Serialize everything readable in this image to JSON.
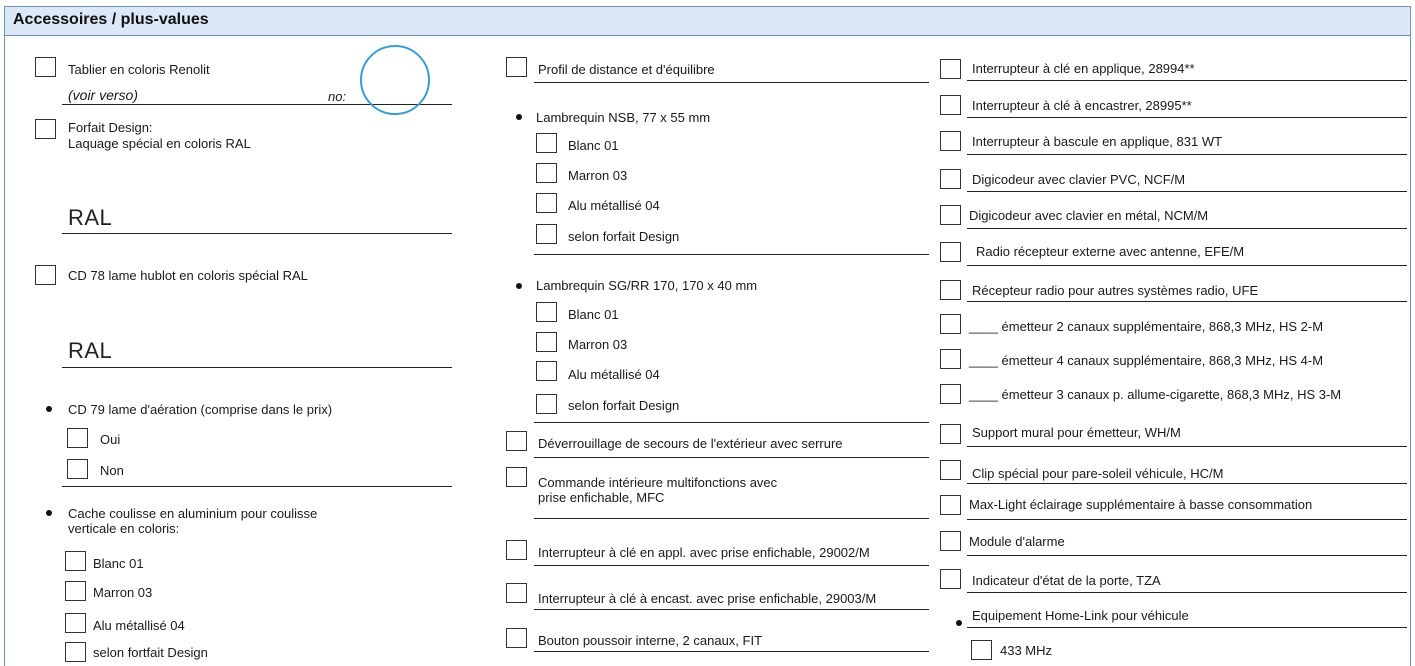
{
  "section_title": "Accessoires / plus-values",
  "col1": {
    "tablier": "Tablier en coloris Renolit",
    "voir_verso": "(voir verso)",
    "no": "no:",
    "forfait_design_1": "Forfait Design:",
    "forfait_design_2": "Laquage spécial en coloris RAL",
    "ral_1": "RAL",
    "cd78": "CD 78 lame hublot en coloris spécial RAL",
    "ral_2": "RAL",
    "cd79": "CD 79 lame d'aération (comprise dans le prix)",
    "oui": "Oui",
    "non": "Non",
    "cache_1": "Cache coulisse en aluminium pour coulisse",
    "cache_2": "verticale en coloris:",
    "blanc": "Blanc 01",
    "marron": "Marron 03",
    "alu": "Alu métallisé 04",
    "selon": "selon fortfait Design"
  },
  "col2": {
    "profil": "Profil de distance et d'équilibre",
    "lambrequin_nsb": "Lambrequin NSB, 77 x 55 mm",
    "nsb_blanc": "Blanc 01",
    "nsb_marron": "Marron 03",
    "nsb_alu": "Alu métallisé 04",
    "nsb_selon": "selon forfait Design",
    "lambrequin_sg": "Lambrequin SG/RR 170, 170 x 40 mm",
    "sg_blanc": "Blanc 01",
    "sg_marron": "Marron 03",
    "sg_alu": "Alu métallisé 04",
    "sg_selon": "selon forfait Design",
    "deverrouillage": "Déverrouillage de secours de l'extérieur avec serrure",
    "commande_1": "Commande intérieure multifonctions avec",
    "commande_2": "prise enfichable, MFC",
    "interrupteur_appl": "Interrupteur à clé en appl. avec prise enfichable, 29002/M",
    "interrupteur_encast": "Interrupteur à clé à encast. avec prise enfichable, 29003/M",
    "bouton": "Bouton poussoir interne, 2 canaux, FIT"
  },
  "col3": {
    "i1": "Interrupteur à clé en applique, 28994**",
    "i2": "Interrupteur à clé à encastrer, 28995**",
    "i3": "Interrupteur à bascule en applique, 831 WT",
    "i4": "Digicodeur avec clavier PVC, NCF/M",
    "i5": "Digicodeur avec clavier en métal, NCM/M",
    "i6": "Radio récepteur externe avec antenne, EFE/M",
    "i7": "Récepteur radio pour autres systèmes radio, UFE",
    "i8": "____ émetteur 2 canaux supplémentaire, 868,3 MHz, HS 2-M",
    "i9": "____ émetteur 4 canaux supplémentaire, 868,3 MHz, HS 4-M",
    "i10": "____ émetteur 3 canaux p. allume-cigarette, 868,3 MHz, HS 3-M",
    "i11": "Support mural pour émetteur, WH/M",
    "i12": "Clip spécial pour pare-soleil véhicule, HC/M",
    "i13": "Max-Light éclairage supplémentaire à basse consommation",
    "i14": "Module d'alarme",
    "i15": "Indicateur d'état de la porte, TZA",
    "i16": "Equipement Home-Link pour véhicule",
    "i17": "433 MHz"
  }
}
